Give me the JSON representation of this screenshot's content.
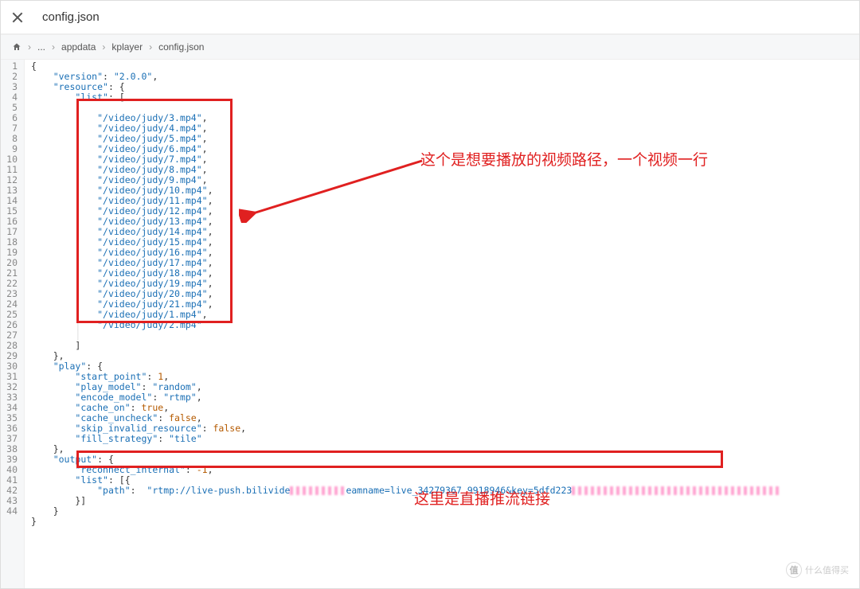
{
  "header": {
    "filename": "config.json"
  },
  "breadcrumb": {
    "ellipsis": "...",
    "seg1": "appdata",
    "seg2": "kplayer",
    "seg3": "config.json"
  },
  "annotations": {
    "t1": "这个是想要播放的视频路径，一个视频一行",
    "t2": "这里是直播推流链接"
  },
  "watermark": {
    "brand": "值",
    "text": "什么值得买"
  },
  "code": {
    "lines": 44,
    "version": "2.0.0",
    "resource_list": [
      "/video/judy/3.mp4",
      "/video/judy/4.mp4",
      "/video/judy/5.mp4",
      "/video/judy/6.mp4",
      "/video/judy/7.mp4",
      "/video/judy/8.mp4",
      "/video/judy/9.mp4",
      "/video/judy/10.mp4",
      "/video/judy/11.mp4",
      "/video/judy/12.mp4",
      "/video/judy/13.mp4",
      "/video/judy/14.mp4",
      "/video/judy/15.mp4",
      "/video/judy/16.mp4",
      "/video/judy/17.mp4",
      "/video/judy/18.mp4",
      "/video/judy/19.mp4",
      "/video/judy/20.mp4",
      "/video/judy/21.mp4",
      "/video/judy/1.mp4",
      "/video/judy/2.mp4"
    ],
    "play": {
      "start_point": 1,
      "play_model": "random",
      "encode_model": "rtmp",
      "cache_on": "true",
      "cache_uncheck": "false",
      "skip_invalid_resource": "false",
      "fill_strategy": "tile"
    },
    "output": {
      "reconnect_internal": -1,
      "path_prefix": "rtmp://live-push.bilivide",
      "path_mid": "eamname=live_34279367_9918946&key=5dfd223"
    }
  }
}
